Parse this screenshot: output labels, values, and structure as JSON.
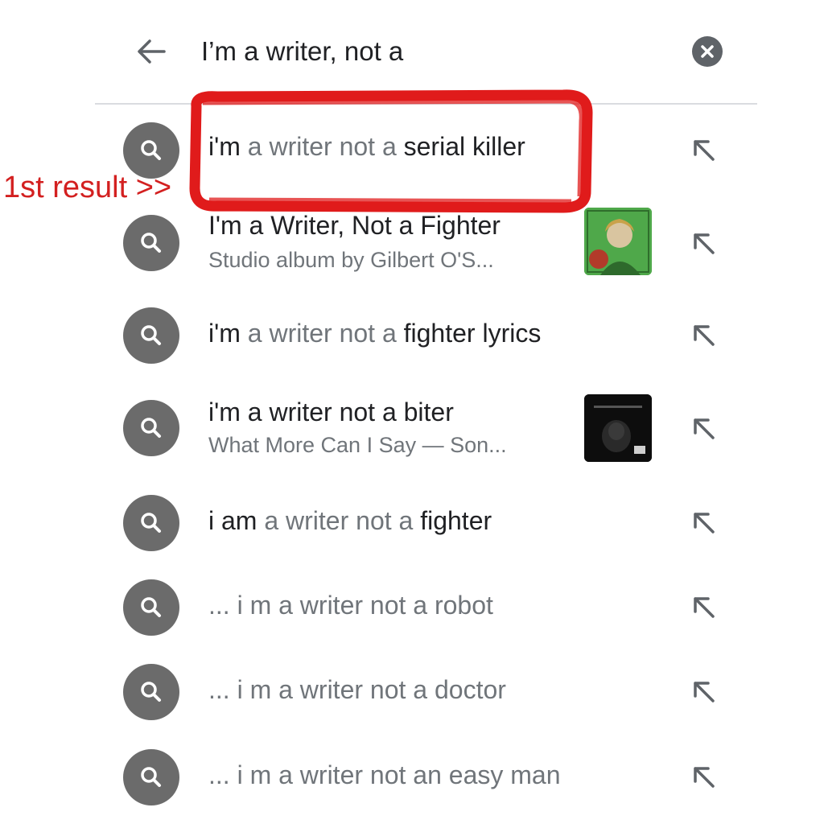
{
  "search": {
    "query": "I’m a writer, not a",
    "back_icon": "arrow-left-icon",
    "clear_icon": "clear-circle-icon"
  },
  "suggestions": [
    {
      "parts": [
        {
          "text": "i'm ",
          "style": "bold"
        },
        {
          "text": "a writer not a ",
          "style": "grey"
        },
        {
          "text": "serial killer",
          "style": "bold"
        }
      ]
    },
    {
      "title": "I'm a Writer, Not a Fighter",
      "subtitle": "Studio album by Gilbert O'S...",
      "thumbnail_icon": "album-cover-green"
    },
    {
      "parts": [
        {
          "text": "i'm ",
          "style": "bold"
        },
        {
          "text": "a writer not a ",
          "style": "grey"
        },
        {
          "text": "fighter lyrics",
          "style": "bold"
        }
      ]
    },
    {
      "title": "i'm a writer not a biter",
      "subtitle": "What More Can I Say — Son...",
      "thumbnail_icon": "album-cover-dark"
    },
    {
      "parts": [
        {
          "text": "i am ",
          "style": "bold"
        },
        {
          "text": "a writer not a ",
          "style": "grey"
        },
        {
          "text": "fighter",
          "style": "bold"
        }
      ]
    },
    {
      "parts": [
        {
          "text": "... i m a writer not a robot",
          "style": "grey"
        }
      ]
    },
    {
      "parts": [
        {
          "text": "... i m a writer not a doctor",
          "style": "grey"
        }
      ]
    },
    {
      "parts": [
        {
          "text": "... i m a writer not an easy man",
          "style": "grey"
        }
      ]
    }
  ],
  "annotation": {
    "label": "1st result >>",
    "color": "#d32020"
  },
  "icons": {
    "row_leading": "search-icon",
    "row_trailing": "fill-query-arrow-icon"
  },
  "colors": {
    "text": "#202124",
    "muted": "#70757a",
    "icon_bg": "#6b6b6b"
  }
}
